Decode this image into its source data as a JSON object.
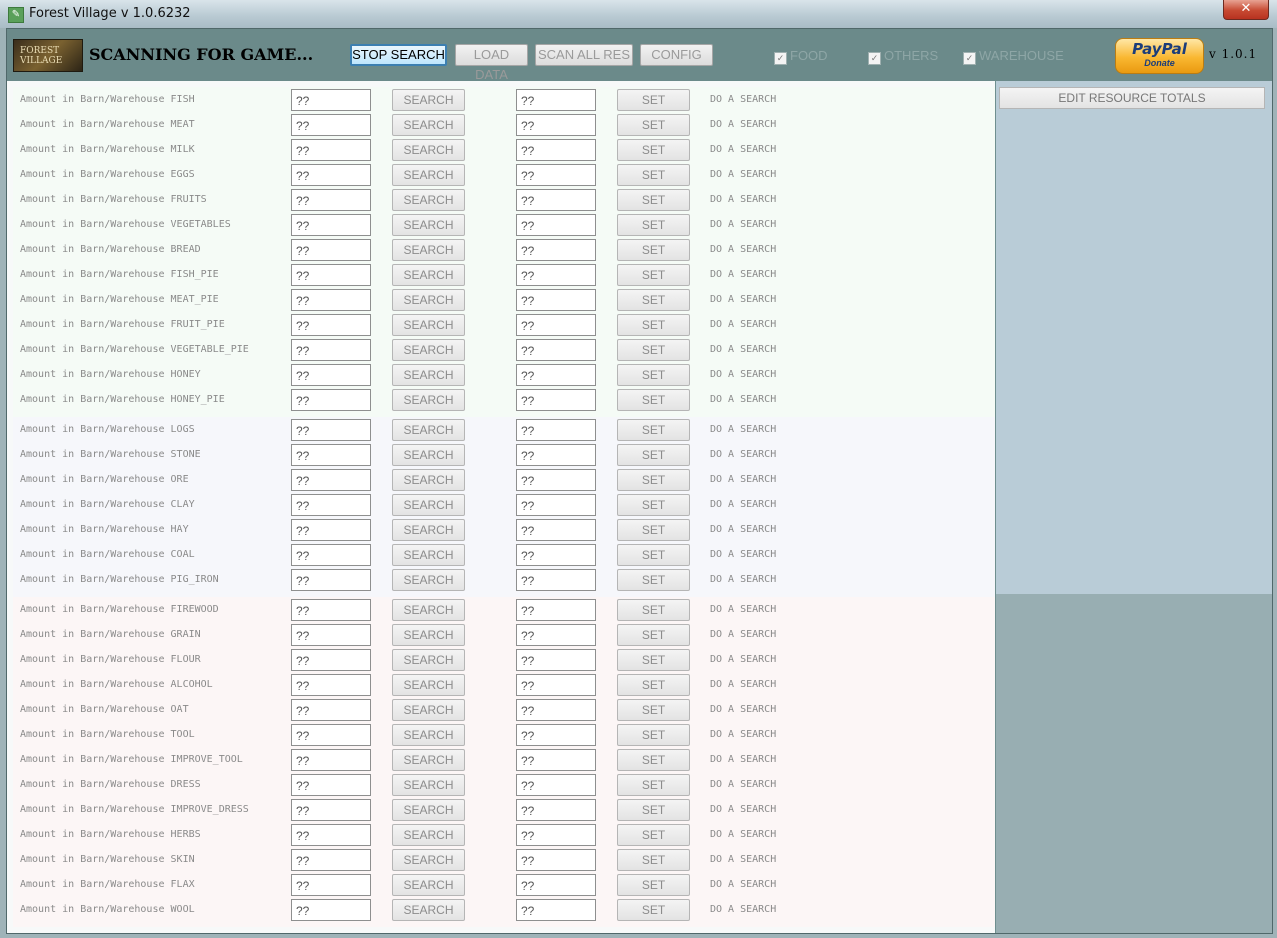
{
  "window": {
    "title": "Forest Village v 1.0.6232",
    "close_label": "✕"
  },
  "toolbar": {
    "logo_text": "FOREST VILLAGE",
    "status": "SCANNING FOR GAME...",
    "buttons": [
      "STOP SEARCH",
      "LOAD DATA",
      "SCAN ALL RES",
      "CONFIG"
    ],
    "checks": [
      {
        "label": "FOOD",
        "checked": true
      },
      {
        "label": "OTHERS",
        "checked": true
      },
      {
        "label": "WAREHOUSE",
        "checked": true
      }
    ],
    "paypal_top": "PayPal",
    "paypal_bottom": "Donate",
    "version": "v 1.0.1"
  },
  "sidebar": {
    "edit_button": "EDIT RESOURCE TOTALS"
  },
  "row_defaults": {
    "label_prefix": "Amount in Barn/Warehouse",
    "value": "??",
    "search_label": "SEARCH",
    "set_label": "SET",
    "status": "DO A SEARCH"
  },
  "groups": [
    {
      "name": "food",
      "resources": [
        "FISH",
        "MEAT",
        "MILK",
        "EGGS",
        "FRUITS",
        "VEGETABLES",
        "BREAD",
        "FISH_PIE",
        "MEAT_PIE",
        "FRUIT_PIE",
        "VEGETABLE_PIE",
        "HONEY",
        "HONEY_PIE"
      ]
    },
    {
      "name": "others",
      "resources": [
        "LOGS",
        "STONE",
        "ORE",
        "CLAY",
        "HAY",
        "COAL",
        "PIG_IRON"
      ]
    },
    {
      "name": "warehouse",
      "resources": [
        "FIREWOOD",
        "GRAIN",
        "FLOUR",
        "ALCOHOL",
        "OAT",
        "TOOL",
        "IMPROVE_TOOL",
        "DRESS",
        "IMPROVE_DRESS",
        "HERBS",
        "SKIN",
        "FLAX",
        "WOOL"
      ]
    }
  ]
}
